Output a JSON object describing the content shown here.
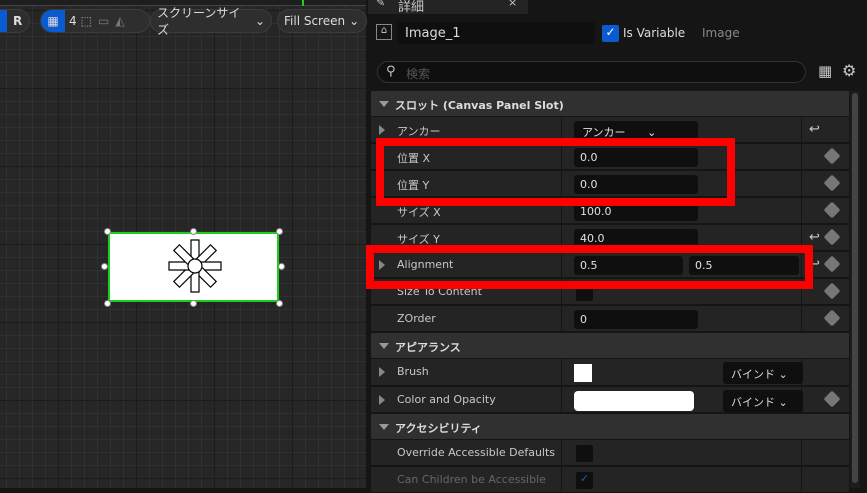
{
  "toolbar": {
    "mode_label": "R",
    "grid_count": "4",
    "screen_size": "スクリーンサイズ",
    "fill_screen": "Fill Screen"
  },
  "panel": {
    "tab_title": "詳細",
    "widget_name": "Image_1",
    "is_variable_label": "Is Variable",
    "is_variable": true,
    "type_label": "Image",
    "search_placeholder": "検索"
  },
  "sections": {
    "slot": "スロット (Canvas Panel Slot)",
    "appearance": "アピアランス",
    "accessibility": "アクセシビリティ"
  },
  "slot": {
    "anchor_label": "アンカー",
    "anchor_value": "アンカー",
    "pos_x_label": "位置 X",
    "pos_x": "0.0",
    "pos_y_label": "位置 Y",
    "pos_y": "0.0",
    "size_x_label": "サイズ X",
    "size_x": "100.0",
    "size_y_label": "サイズ Y",
    "size_y": "40.0",
    "alignment_label": "Alignment",
    "alignment_x": "0.5",
    "alignment_y": "0.5",
    "size_to_content_label": "Size To Content",
    "zorder_label": "ZOrder",
    "zorder": "0"
  },
  "appearance": {
    "brush_label": "Brush",
    "color_label": "Color and Opacity",
    "bind_label": "バインド"
  },
  "accessibility": {
    "override_label": "Override Accessible Defaults",
    "children_label": "Can Children be Accessible"
  }
}
